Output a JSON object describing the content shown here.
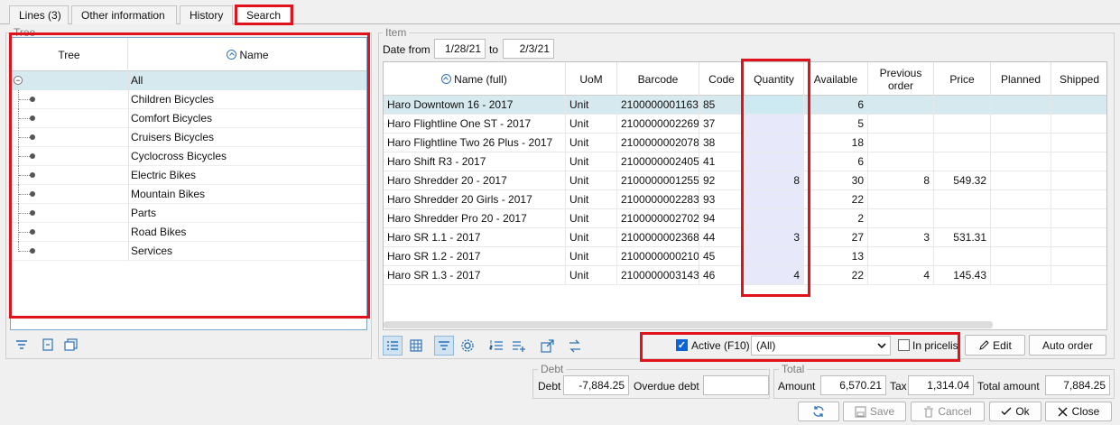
{
  "tabs": [
    {
      "label": "Lines (3)"
    },
    {
      "label": "Other information"
    },
    {
      "label": "History"
    },
    {
      "label": "Search"
    }
  ],
  "tree_panel": {
    "title": "Tree",
    "col_tree": "Tree",
    "col_name": "Name",
    "root": "All",
    "items": [
      "Children Bicycles",
      "Comfort Bicycles",
      "Cruisers Bicycles",
      "Cyclocross Bicycles",
      "Electric Bikes",
      "Mountain Bikes",
      "Parts",
      "Road Bikes",
      "Services"
    ]
  },
  "item_panel": {
    "title": "Item",
    "date_from_label": "Date from",
    "date_from": "1/28/21",
    "to_label": "to",
    "date_to": "2/3/21",
    "columns": [
      "Name (full)",
      "UoM",
      "Barcode",
      "Code",
      "Quantity",
      "Available",
      "Previous order",
      "Price",
      "Planned",
      "Shipped"
    ],
    "rows": [
      {
        "name": "Haro Downtown 16 - 2017",
        "uom": "Unit",
        "barcode": "2100000001163",
        "code": "85",
        "quantity": "",
        "available": "6",
        "prev": "",
        "price": "",
        "planned": "",
        "shipped": ""
      },
      {
        "name": "Haro Flightline One ST - 2017",
        "uom": "Unit",
        "barcode": "2100000002269",
        "code": "37",
        "quantity": "",
        "available": "5",
        "prev": "",
        "price": "",
        "planned": "",
        "shipped": ""
      },
      {
        "name": "Haro Flightline Two 26 Plus - 2017",
        "uom": "Unit",
        "barcode": "2100000002078",
        "code": "38",
        "quantity": "",
        "available": "18",
        "prev": "",
        "price": "",
        "planned": "",
        "shipped": ""
      },
      {
        "name": "Haro Shift R3 - 2017",
        "uom": "Unit",
        "barcode": "2100000002405",
        "code": "41",
        "quantity": "",
        "available": "6",
        "prev": "",
        "price": "",
        "planned": "",
        "shipped": ""
      },
      {
        "name": "Haro Shredder 20 - 2017",
        "uom": "Unit",
        "barcode": "2100000001255",
        "code": "92",
        "quantity": "8",
        "available": "30",
        "prev": "8",
        "price": "549.32",
        "planned": "",
        "shipped": ""
      },
      {
        "name": "Haro Shredder 20 Girls - 2017",
        "uom": "Unit",
        "barcode": "2100000002283",
        "code": "93",
        "quantity": "",
        "available": "22",
        "prev": "",
        "price": "",
        "planned": "",
        "shipped": ""
      },
      {
        "name": "Haro Shredder Pro 20 - 2017",
        "uom": "Unit",
        "barcode": "2100000002702",
        "code": "94",
        "quantity": "",
        "available": "2",
        "prev": "",
        "price": "",
        "planned": "",
        "shipped": ""
      },
      {
        "name": "Haro SR 1.1 - 2017",
        "uom": "Unit",
        "barcode": "2100000002368",
        "code": "44",
        "quantity": "3",
        "available": "27",
        "prev": "3",
        "price": "531.31",
        "planned": "",
        "shipped": ""
      },
      {
        "name": "Haro SR 1.2 - 2017",
        "uom": "Unit",
        "barcode": "2100000000210",
        "code": "45",
        "quantity": "",
        "available": "13",
        "prev": "",
        "price": "",
        "planned": "",
        "shipped": ""
      },
      {
        "name": "Haro SR 1.3 - 2017",
        "uom": "Unit",
        "barcode": "2100000003143",
        "code": "46",
        "quantity": "4",
        "available": "22",
        "prev": "4",
        "price": "145.43",
        "planned": "",
        "shipped": ""
      }
    ],
    "active_label": "Active (F10)",
    "active_checked": true,
    "filter_value": "(All)",
    "in_pricelist_label": "In pricelist",
    "edit_label": "Edit",
    "auto_order_label": "Auto order"
  },
  "debt": {
    "title": "Debt",
    "debt_label": "Debt",
    "debt_value": "-7,884.25",
    "overdue_label": "Overdue debt",
    "overdue_value": ""
  },
  "total": {
    "title": "Total",
    "amount_label": "Amount",
    "amount_value": "6,570.21",
    "tax_label": "Tax",
    "tax_value": "1,314.04",
    "total_label": "Total amount",
    "total_value": "7,884.25"
  },
  "buttons": {
    "save": "Save",
    "cancel": "Cancel",
    "ok": "Ok",
    "close": "Close"
  },
  "colors": {
    "highlight": "#e0121b",
    "selected_row": "#d6e9ee",
    "quantity_col": "#e8e8fb",
    "accent": "#2c73b8"
  }
}
